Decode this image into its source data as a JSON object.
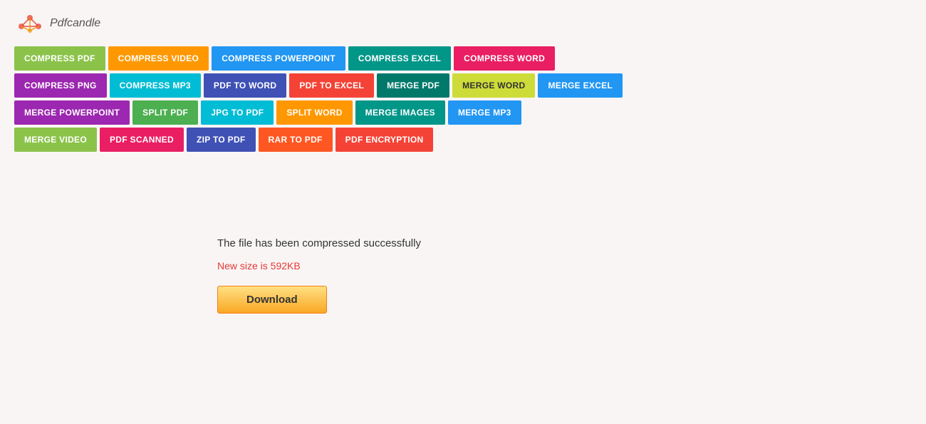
{
  "logo": {
    "text": "Pdfcandle"
  },
  "nav": {
    "rows": [
      [
        {
          "label": "COMPRESS PDF",
          "color": "bg-green"
        },
        {
          "label": "COMPRESS VIDEO",
          "color": "bg-orange"
        },
        {
          "label": "COMPRESS POWERPOINT",
          "color": "bg-blue"
        },
        {
          "label": "COMPRESS EXCEL",
          "color": "bg-teal"
        },
        {
          "label": "COMPRESS WORD",
          "color": "bg-pink"
        }
      ],
      [
        {
          "label": "COMPRESS PNG",
          "color": "bg-purple"
        },
        {
          "label": "COMPRESS MP3",
          "color": "bg-cyan"
        },
        {
          "label": "PDF TO WORD",
          "color": "bg-indigo"
        },
        {
          "label": "PDF TO EXCEL",
          "color": "bg-red"
        },
        {
          "label": "MERGE PDF",
          "color": "bg-dark-teal"
        },
        {
          "label": "MERGE WORD",
          "color": "bg-lime"
        },
        {
          "label": "MERGE EXCEL",
          "color": "bg-blue"
        }
      ],
      [
        {
          "label": "MERGE POWERPOINT",
          "color": "bg-purple"
        },
        {
          "label": "SPLIT PDF",
          "color": "bg-green2"
        },
        {
          "label": "JPG TO PDF",
          "color": "bg-cyan"
        },
        {
          "label": "SPLIT WORD",
          "color": "bg-orange"
        },
        {
          "label": "MERGE IMAGES",
          "color": "bg-teal"
        },
        {
          "label": "MERGE MP3",
          "color": "bg-blue"
        }
      ],
      [
        {
          "label": "MERGE VIDEO",
          "color": "bg-green"
        },
        {
          "label": "PDF SCANNED",
          "color": "bg-pink"
        },
        {
          "label": "ZIP TO PDF",
          "color": "bg-indigo"
        },
        {
          "label": "RAR TO PDF",
          "color": "bg-deep-orange"
        },
        {
          "label": "PDF ENCRYPTION",
          "color": "bg-red"
        }
      ]
    ]
  },
  "main": {
    "success_message": "The file has been compressed successfully",
    "size_label": "New size is 592KB",
    "download_label": "Download"
  }
}
